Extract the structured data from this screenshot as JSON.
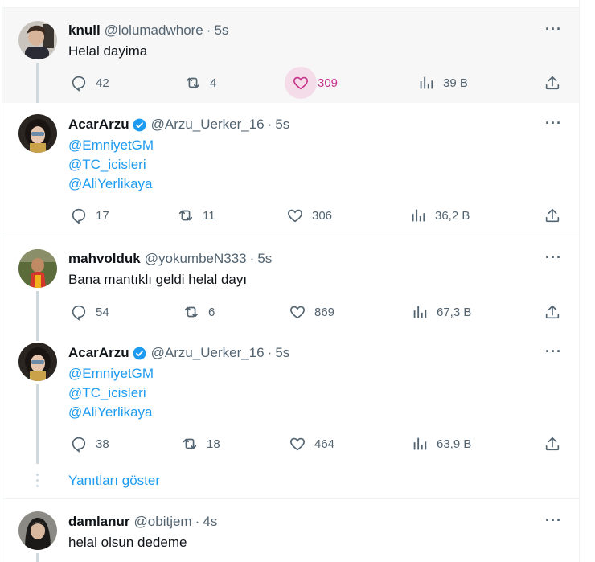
{
  "tweets": [
    {
      "name": "knull",
      "handle": "@lolumadwhore",
      "time": "5s",
      "verified": false,
      "text": "Helal dayima",
      "mentions": [],
      "stats": {
        "replies": "42",
        "retweets": "4",
        "likes": "309",
        "views": "39 B"
      },
      "liked": true
    },
    {
      "name": "AcarArzu",
      "handle": "@Arzu_Uerker_16",
      "time": "5s",
      "verified": true,
      "text": "",
      "mentions": [
        "@EmniyetGM",
        "@TC_icisleri",
        "@AliYerlikaya"
      ],
      "stats": {
        "replies": "17",
        "retweets": "11",
        "likes": "306",
        "views": "36,2 B"
      },
      "liked": false
    },
    {
      "name": "mahvolduk",
      "handle": "@yokumbeN333",
      "time": "5s",
      "verified": false,
      "text": "Bana mantıklı geldi helal dayı",
      "mentions": [],
      "stats": {
        "replies": "54",
        "retweets": "6",
        "likes": "869",
        "views": "67,3 B"
      },
      "liked": false
    },
    {
      "name": "AcarArzu",
      "handle": "@Arzu_Uerker_16",
      "time": "5s",
      "verified": true,
      "text": "",
      "mentions": [
        "@EmniyetGM",
        "@TC_icisleri",
        "@AliYerlikaya"
      ],
      "stats": {
        "replies": "38",
        "retweets": "18",
        "likes": "464",
        "views": "63,9 B"
      },
      "liked": false
    },
    {
      "name": "damlanur",
      "handle": "@obitjem",
      "time": "4s",
      "verified": false,
      "text": "helal olsun dedeme",
      "mentions": [],
      "stats": {},
      "liked": false
    }
  ],
  "show_replies_label": "Yanıtları göster",
  "more_label": "···",
  "dot": "·",
  "colors": {
    "accent": "#1d9bf0",
    "like": "#f91880",
    "muted": "#536471",
    "highlight_bg": "#f7f7f7"
  }
}
